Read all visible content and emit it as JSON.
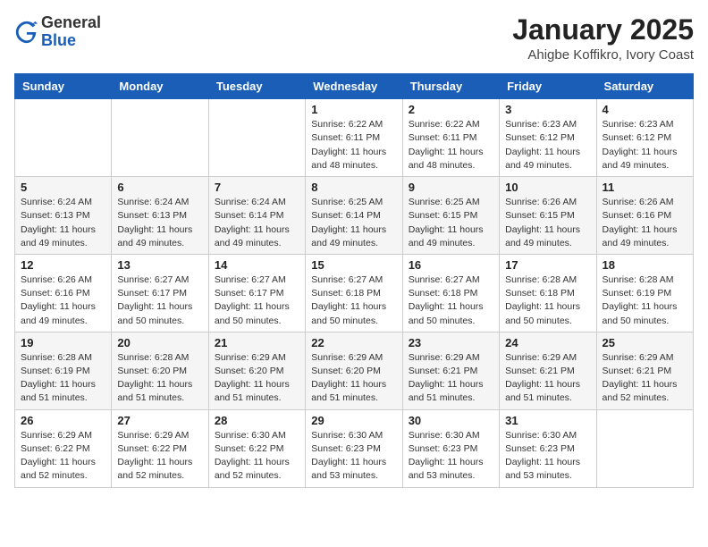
{
  "header": {
    "logo_general": "General",
    "logo_blue": "Blue",
    "month_title": "January 2025",
    "location": "Ahigbe Koffikro, Ivory Coast"
  },
  "calendar": {
    "days_of_week": [
      "Sunday",
      "Monday",
      "Tuesday",
      "Wednesday",
      "Thursday",
      "Friday",
      "Saturday"
    ],
    "weeks": [
      [
        {
          "day": "",
          "info": ""
        },
        {
          "day": "",
          "info": ""
        },
        {
          "day": "",
          "info": ""
        },
        {
          "day": "1",
          "info": "Sunrise: 6:22 AM\nSunset: 6:11 PM\nDaylight: 11 hours\nand 48 minutes."
        },
        {
          "day": "2",
          "info": "Sunrise: 6:22 AM\nSunset: 6:11 PM\nDaylight: 11 hours\nand 48 minutes."
        },
        {
          "day": "3",
          "info": "Sunrise: 6:23 AM\nSunset: 6:12 PM\nDaylight: 11 hours\nand 49 minutes."
        },
        {
          "day": "4",
          "info": "Sunrise: 6:23 AM\nSunset: 6:12 PM\nDaylight: 11 hours\nand 49 minutes."
        }
      ],
      [
        {
          "day": "5",
          "info": "Sunrise: 6:24 AM\nSunset: 6:13 PM\nDaylight: 11 hours\nand 49 minutes."
        },
        {
          "day": "6",
          "info": "Sunrise: 6:24 AM\nSunset: 6:13 PM\nDaylight: 11 hours\nand 49 minutes."
        },
        {
          "day": "7",
          "info": "Sunrise: 6:24 AM\nSunset: 6:14 PM\nDaylight: 11 hours\nand 49 minutes."
        },
        {
          "day": "8",
          "info": "Sunrise: 6:25 AM\nSunset: 6:14 PM\nDaylight: 11 hours\nand 49 minutes."
        },
        {
          "day": "9",
          "info": "Sunrise: 6:25 AM\nSunset: 6:15 PM\nDaylight: 11 hours\nand 49 minutes."
        },
        {
          "day": "10",
          "info": "Sunrise: 6:26 AM\nSunset: 6:15 PM\nDaylight: 11 hours\nand 49 minutes."
        },
        {
          "day": "11",
          "info": "Sunrise: 6:26 AM\nSunset: 6:16 PM\nDaylight: 11 hours\nand 49 minutes."
        }
      ],
      [
        {
          "day": "12",
          "info": "Sunrise: 6:26 AM\nSunset: 6:16 PM\nDaylight: 11 hours\nand 49 minutes."
        },
        {
          "day": "13",
          "info": "Sunrise: 6:27 AM\nSunset: 6:17 PM\nDaylight: 11 hours\nand 50 minutes."
        },
        {
          "day": "14",
          "info": "Sunrise: 6:27 AM\nSunset: 6:17 PM\nDaylight: 11 hours\nand 50 minutes."
        },
        {
          "day": "15",
          "info": "Sunrise: 6:27 AM\nSunset: 6:18 PM\nDaylight: 11 hours\nand 50 minutes."
        },
        {
          "day": "16",
          "info": "Sunrise: 6:27 AM\nSunset: 6:18 PM\nDaylight: 11 hours\nand 50 minutes."
        },
        {
          "day": "17",
          "info": "Sunrise: 6:28 AM\nSunset: 6:18 PM\nDaylight: 11 hours\nand 50 minutes."
        },
        {
          "day": "18",
          "info": "Sunrise: 6:28 AM\nSunset: 6:19 PM\nDaylight: 11 hours\nand 50 minutes."
        }
      ],
      [
        {
          "day": "19",
          "info": "Sunrise: 6:28 AM\nSunset: 6:19 PM\nDaylight: 11 hours\nand 51 minutes."
        },
        {
          "day": "20",
          "info": "Sunrise: 6:28 AM\nSunset: 6:20 PM\nDaylight: 11 hours\nand 51 minutes."
        },
        {
          "day": "21",
          "info": "Sunrise: 6:29 AM\nSunset: 6:20 PM\nDaylight: 11 hours\nand 51 minutes."
        },
        {
          "day": "22",
          "info": "Sunrise: 6:29 AM\nSunset: 6:20 PM\nDaylight: 11 hours\nand 51 minutes."
        },
        {
          "day": "23",
          "info": "Sunrise: 6:29 AM\nSunset: 6:21 PM\nDaylight: 11 hours\nand 51 minutes."
        },
        {
          "day": "24",
          "info": "Sunrise: 6:29 AM\nSunset: 6:21 PM\nDaylight: 11 hours\nand 51 minutes."
        },
        {
          "day": "25",
          "info": "Sunrise: 6:29 AM\nSunset: 6:21 PM\nDaylight: 11 hours\nand 52 minutes."
        }
      ],
      [
        {
          "day": "26",
          "info": "Sunrise: 6:29 AM\nSunset: 6:22 PM\nDaylight: 11 hours\nand 52 minutes."
        },
        {
          "day": "27",
          "info": "Sunrise: 6:29 AM\nSunset: 6:22 PM\nDaylight: 11 hours\nand 52 minutes."
        },
        {
          "day": "28",
          "info": "Sunrise: 6:30 AM\nSunset: 6:22 PM\nDaylight: 11 hours\nand 52 minutes."
        },
        {
          "day": "29",
          "info": "Sunrise: 6:30 AM\nSunset: 6:23 PM\nDaylight: 11 hours\nand 53 minutes."
        },
        {
          "day": "30",
          "info": "Sunrise: 6:30 AM\nSunset: 6:23 PM\nDaylight: 11 hours\nand 53 minutes."
        },
        {
          "day": "31",
          "info": "Sunrise: 6:30 AM\nSunset: 6:23 PM\nDaylight: 11 hours\nand 53 minutes."
        },
        {
          "day": "",
          "info": ""
        }
      ]
    ]
  }
}
